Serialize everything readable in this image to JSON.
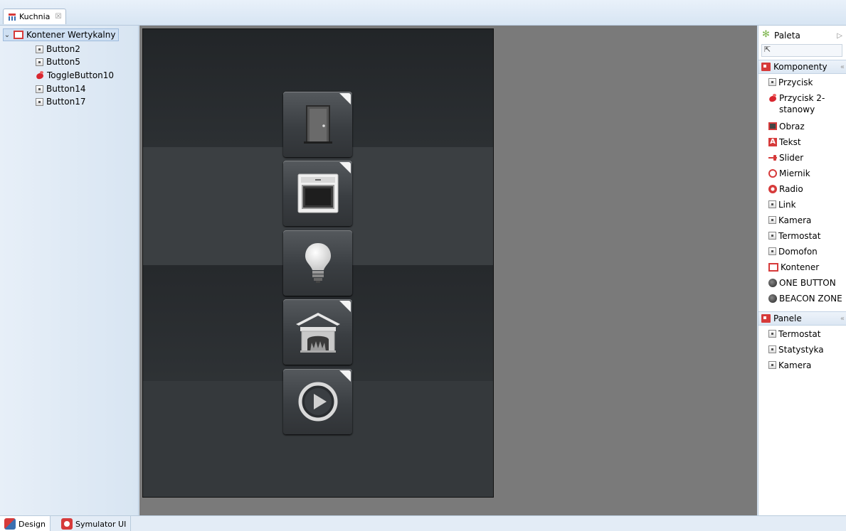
{
  "editor": {
    "tab_title": "Kuchnia",
    "close_glyph": "☒"
  },
  "tree": {
    "root": {
      "label": "Kontener Wertykalny",
      "icon": "container-icon"
    },
    "children": [
      {
        "label": "Button2",
        "icon": "button-icon"
      },
      {
        "label": "Button5",
        "icon": "button-icon"
      },
      {
        "label": "ToggleButton10",
        "icon": "toggle-button-icon"
      },
      {
        "label": "Button14",
        "icon": "button-icon"
      },
      {
        "label": "Button17",
        "icon": "button-icon"
      }
    ]
  },
  "canvas": {
    "tiles": [
      {
        "icon": "door-icon",
        "has_corner": true
      },
      {
        "icon": "oven-icon",
        "has_corner": true
      },
      {
        "icon": "light-bulb-icon",
        "has_corner": false
      },
      {
        "icon": "fireplace-icon",
        "has_corner": true
      },
      {
        "icon": "play-icon",
        "has_corner": true
      }
    ]
  },
  "palette": {
    "title": "Paleta",
    "components_label": "Komponenty",
    "components": [
      {
        "label": "Przycisk",
        "icon": "button-icon"
      },
      {
        "label": "Przycisk 2-stanowy",
        "icon": "toggle-button-icon"
      },
      {
        "label": "Obraz",
        "icon": "image-icon"
      },
      {
        "label": "Tekst",
        "icon": "text-icon"
      },
      {
        "label": "Slider",
        "icon": "slider-icon"
      },
      {
        "label": "Miernik",
        "icon": "gauge-icon"
      },
      {
        "label": "Radio",
        "icon": "radio-icon"
      },
      {
        "label": "Link",
        "icon": "button-icon"
      },
      {
        "label": "Kamera",
        "icon": "button-icon"
      },
      {
        "label": "Termostat",
        "icon": "button-icon"
      },
      {
        "label": "Domofon",
        "icon": "button-icon"
      },
      {
        "label": "Kontener",
        "icon": "container-icon"
      },
      {
        "label": "ONE BUTTON",
        "icon": "dark-circle-icon"
      },
      {
        "label": "BEACON ZONE",
        "icon": "dark-circle-icon"
      }
    ],
    "panels_label": "Panele",
    "panels": [
      {
        "label": "Termostat",
        "icon": "button-icon"
      },
      {
        "label": "Statystyka",
        "icon": "button-icon"
      },
      {
        "label": "Kamera",
        "icon": "button-icon"
      }
    ]
  },
  "bottom_tabs": {
    "design": "Design",
    "simulator": "Symulator UI"
  },
  "colors": {
    "accent": "#d63a3a",
    "chrome": "#dce8f4",
    "canvas": "#7a7a7a"
  }
}
